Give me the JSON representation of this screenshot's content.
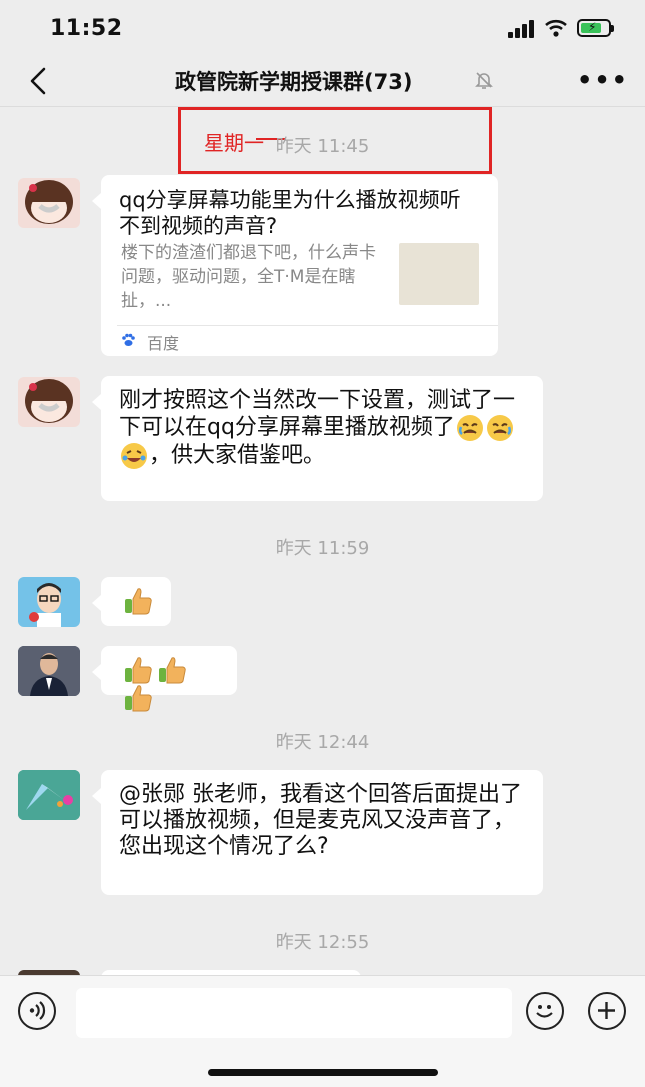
{
  "status": {
    "time": "11:52",
    "battery_color": "#3ac25a"
  },
  "header": {
    "title": "政管院新学期授课群(73)",
    "back_icon": "chevron-left-icon",
    "mute_icon": "bell-slash-icon",
    "more_icon": "ellipsis-icon"
  },
  "annotation": {
    "text": "星期一",
    "color": "#e02424"
  },
  "messages": {
    "ts1": "昨天 11:45",
    "card": {
      "title": "qq分享屏幕功能里为什么播放视频听不到视频的声音?",
      "desc": "楼下的渣渣们都退下吧，什么声卡问题，驱动问题，全T·M是在瞎扯，...",
      "source": "百度"
    },
    "msg2": {
      "before": "刚才按照这个当然改一下设置，测试了一下可以在qq分享屏幕里播放视频了",
      "after": "，供大家借鉴吧。"
    },
    "ts2": "昨天 11:59",
    "ts3": "昨天 12:44",
    "msg5": "@张郧 张老师，我看这个回答后面提出了 可以播放视频，但是麦克风又没声音了，您出现这个情况了么?",
    "ts4": "昨天 12:55"
  },
  "input": {
    "placeholder": "",
    "voice_icon": "voice-icon",
    "emoji_icon": "smiley-icon",
    "plus_icon": "plus-circle-icon"
  }
}
